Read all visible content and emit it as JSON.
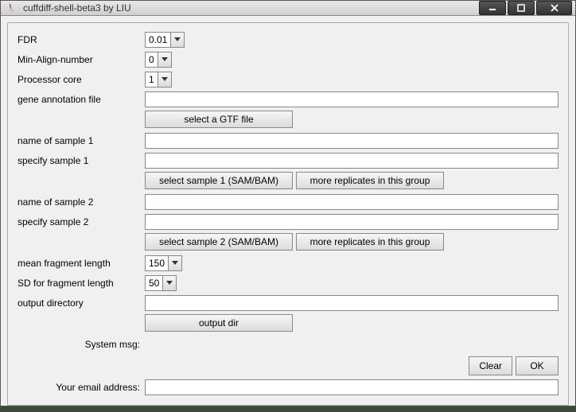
{
  "window": {
    "title": "cuffdiff-shell-beta3 by LIU"
  },
  "labels": {
    "fdr": "FDR",
    "min_align": "Min-Align-number",
    "processor": "Processor core",
    "gtf": "gene annotation file",
    "sample1_name": "name of sample 1",
    "sample1_spec": "specify sample 1",
    "sample2_name": "name of sample 2",
    "sample2_spec": "specify sample 2",
    "mean_frag": "mean fragment length",
    "sd_frag": "SD for fragment length",
    "output_dir": "output directory",
    "sys_msg": "System msg:",
    "email": "Your email address:"
  },
  "values": {
    "fdr": "0.01",
    "min_align": "0",
    "processor": "1",
    "gtf": "",
    "sample1_name": "",
    "sample1_spec": "",
    "sample2_name": "",
    "sample2_spec": "",
    "mean_frag": "150",
    "sd_frag": "50",
    "output_dir": "",
    "email": ""
  },
  "buttons": {
    "select_gtf": "select a GTF file",
    "select_sample1": "select sample 1 (SAM/BAM)",
    "more_rep1": "more replicates in this group",
    "select_sample2": "select sample 2 (SAM/BAM)",
    "more_rep2": "more replicates in this group",
    "output_dir": "output dir",
    "clear": "Clear",
    "ok": "OK"
  }
}
